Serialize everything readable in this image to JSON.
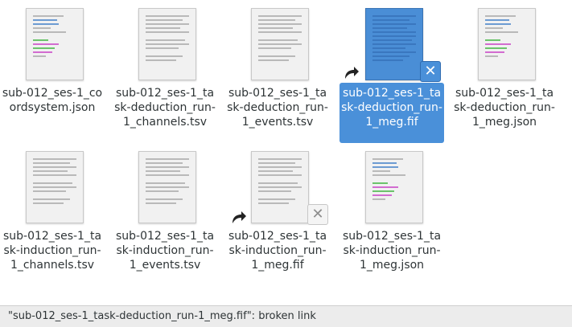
{
  "files": [
    {
      "name": "sub-012_ses-1_coordsystem.json",
      "type": "json-text",
      "selected": false,
      "broken_link": false
    },
    {
      "name": "sub-012_ses-1_task-deduction_run-1_channels.tsv",
      "type": "plain-text",
      "selected": false,
      "broken_link": false
    },
    {
      "name": "sub-012_ses-1_task-deduction_run-1_events.tsv",
      "type": "plain-text",
      "selected": false,
      "broken_link": false
    },
    {
      "name": "sub-012_ses-1_task-deduction_run-1_meg.fif",
      "type": "broken-link",
      "selected": true,
      "broken_link": true
    },
    {
      "name": "sub-012_ses-1_task-deduction_run-1_meg.json",
      "type": "json-text",
      "selected": false,
      "broken_link": false
    },
    {
      "name": "sub-012_ses-1_task-induction_run-1_channels.tsv",
      "type": "plain-text",
      "selected": false,
      "broken_link": false
    },
    {
      "name": "sub-012_ses-1_task-induction_run-1_events.tsv",
      "type": "plain-text",
      "selected": false,
      "broken_link": false
    },
    {
      "name": "sub-012_ses-1_task-induction_run-1_meg.fif",
      "type": "broken-link",
      "selected": false,
      "broken_link": true
    },
    {
      "name": "sub-012_ses-1_task-induction_run-1_meg.json",
      "type": "json-text",
      "selected": false,
      "broken_link": false
    }
  ],
  "status": {
    "text": "\"sub-012_ses-1_task-deduction_run-1_meg.fif\": broken link"
  },
  "icons": {
    "link_emblem": "symlink-arrow-icon",
    "broken_emblem": "broken-x-icon"
  },
  "colors": {
    "selection": "#4a90d9",
    "text": "#2e3436",
    "statusbar": "#ececec"
  }
}
